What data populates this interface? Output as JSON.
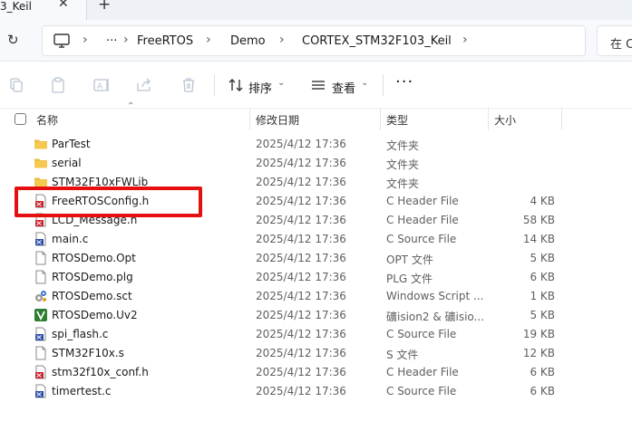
{
  "tab": {
    "title": "3_Keil",
    "close": "✕",
    "new_tab": "+"
  },
  "address": {
    "refresh": "↻",
    "more": "···",
    "crumbs": [
      "FreeRTOS",
      "Demo",
      "CORTEX_STM32F103_Keil"
    ],
    "search_text": "在 C"
  },
  "toolbar": {
    "sort_label": "排序",
    "view_label": "查看",
    "more": "···"
  },
  "columns": {
    "name": "名称",
    "date": "修改日期",
    "type": "类型",
    "size": "大小"
  },
  "files": [
    {
      "name": "ParTest",
      "date": "2025/4/12 17:36",
      "type": "文件夹",
      "size": "",
      "icon": "folder-icon"
    },
    {
      "name": "serial",
      "date": "2025/4/12 17:36",
      "type": "文件夹",
      "size": "",
      "icon": "folder-icon"
    },
    {
      "name": "STM32F10xFWLib",
      "date": "2025/4/12 17:36",
      "type": "文件夹",
      "size": "",
      "icon": "folder-icon"
    },
    {
      "name": "FreeRTOSConfig.h",
      "date": "2025/4/12 17:36",
      "type": "C Header File",
      "size": "4 KB",
      "icon": "c-header-file-icon"
    },
    {
      "name": "LCD_Message.h",
      "date": "2025/4/12 17:36",
      "type": "C Header File",
      "size": "58 KB",
      "icon": "c-header-file-icon"
    },
    {
      "name": "main.c",
      "date": "2025/4/12 17:36",
      "type": "C Source File",
      "size": "14 KB",
      "icon": "c-source-file-icon"
    },
    {
      "name": "RTOSDemo.Opt",
      "date": "2025/4/12 17:36",
      "type": "OPT 文件",
      "size": "5 KB",
      "icon": "generic-file-icon"
    },
    {
      "name": "RTOSDemo.plg",
      "date": "2025/4/12 17:36",
      "type": "PLG 文件",
      "size": "6 KB",
      "icon": "generic-file-icon"
    },
    {
      "name": "RTOSDemo.sct",
      "date": "2025/4/12 17:36",
      "type": "Windows Script ...",
      "size": "1 KB",
      "icon": "script-file-icon"
    },
    {
      "name": "RTOSDemo.Uv2",
      "date": "2025/4/12 17:36",
      "type": "礦ision2 & 礦isio...",
      "size": "5 KB",
      "icon": "keil-project-icon"
    },
    {
      "name": "spi_flash.c",
      "date": "2025/4/12 17:36",
      "type": "C Source File",
      "size": "19 KB",
      "icon": "c-source-file-icon"
    },
    {
      "name": "STM32F10x.s",
      "date": "2025/4/12 17:36",
      "type": "S 文件",
      "size": "12 KB",
      "icon": "generic-file-icon"
    },
    {
      "name": "stm32f10x_conf.h",
      "date": "2025/4/12 17:36",
      "type": "C Header File",
      "size": "6 KB",
      "icon": "c-header-file-icon"
    },
    {
      "name": "timertest.c",
      "date": "2025/4/12 17:36",
      "type": "C Source File",
      "size": "6 KB",
      "icon": "c-source-file-icon"
    }
  ],
  "colors": {
    "highlight": "#e60f0f",
    "folder": "#f3c44e",
    "accent": "#2f6fd6"
  }
}
